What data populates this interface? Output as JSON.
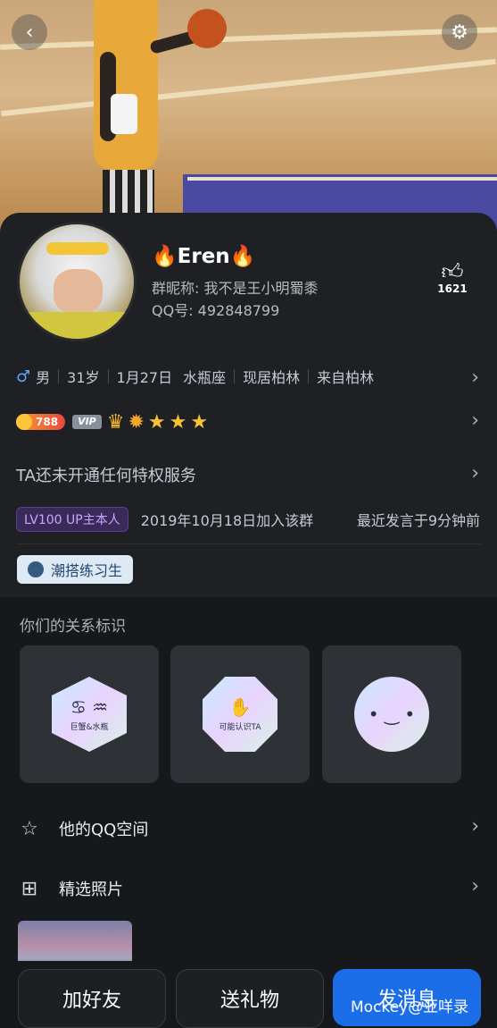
{
  "header": {
    "back_icon": "back-arrow-icon",
    "settings_icon": "gear-icon"
  },
  "profile": {
    "name": "🔥Eren🔥",
    "group_nickname": "群昵称: 我不是王小明蜀黍",
    "qq": "QQ号: 492848799",
    "likes": "1621"
  },
  "info": {
    "gender": "男",
    "age": "31岁",
    "birthday": "1月27日",
    "zodiac": "水瓶座",
    "residence": "现居柏林",
    "hometown": "来自柏林"
  },
  "level": {
    "coins": "788",
    "vip": "VIP"
  },
  "privilege": "TA还未开通任何特权服务",
  "group": {
    "level_badge": "LV100 UP主本人",
    "joined": "2019年10月18日加入该群",
    "last_speak": "最近发言于9分钟前"
  },
  "tag": "潮搭练习生",
  "relations": {
    "title": "你们的关系标识",
    "items": [
      {
        "label": "巨蟹&水瓶",
        "symbol": "♋ ♒"
      },
      {
        "label": "可能认识TA",
        "symbol": "✋"
      },
      {
        "label": "",
        "symbol": "• ‿ •"
      }
    ]
  },
  "menu": [
    {
      "label": "他的QQ空间",
      "icon": "star-icon"
    },
    {
      "label": "精选照片",
      "icon": "grid-icon"
    }
  ],
  "actions": {
    "add_friend": "加好友",
    "send_gift": "送礼物",
    "send_message": "发消息"
  },
  "watermark": "Mockey@亚咩录"
}
